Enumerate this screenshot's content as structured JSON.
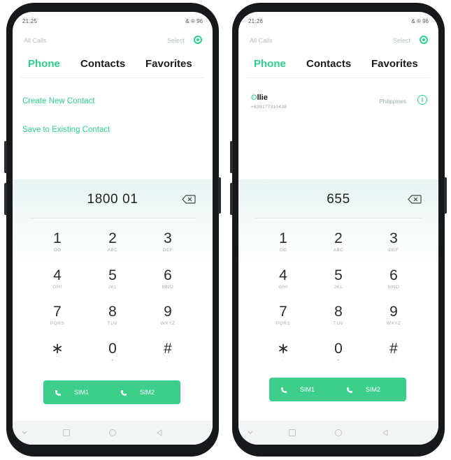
{
  "left_phone": {
    "status_time": "21:25",
    "status_right": "& ® 96",
    "calls_filter": "All Calls",
    "select_label": "Select",
    "tabs": [
      {
        "label": "Phone"
      },
      {
        "label": "Contacts"
      },
      {
        "label": "Favorites"
      }
    ],
    "actions": [
      {
        "label": "Create New Contact"
      },
      {
        "label": "Save to Existing Contact"
      }
    ],
    "dialed_number": "1800 01",
    "sim_buttons": [
      {
        "label": "SIM1"
      },
      {
        "label": "SIM2"
      }
    ]
  },
  "right_phone": {
    "status_time": "21:26",
    "status_right": "& ® 96",
    "calls_filter": "All Calls",
    "select_label": "Select",
    "tabs": [
      {
        "label": "Phone"
      },
      {
        "label": "Contacts"
      },
      {
        "label": "Favorites"
      }
    ],
    "contact": {
      "name_match": "O",
      "name_rest": "llie",
      "number": "+639177310438",
      "country": "Philippines"
    },
    "dialed_number": "655",
    "sim_buttons": [
      {
        "label": "SIM1"
      },
      {
        "label": "SIM2"
      }
    ]
  },
  "keypad": [
    {
      "digit": "1",
      "letters": "OO"
    },
    {
      "digit": "2",
      "letters": "ABC"
    },
    {
      "digit": "3",
      "letters": "DEF"
    },
    {
      "digit": "4",
      "letters": "GHI"
    },
    {
      "digit": "5",
      "letters": "JKL"
    },
    {
      "digit": "6",
      "letters": "MNO"
    },
    {
      "digit": "7",
      "letters": "PQRS"
    },
    {
      "digit": "8",
      "letters": "TUV"
    },
    {
      "digit": "9",
      "letters": "WXYZ"
    },
    {
      "digit": "∗",
      "letters": "·"
    },
    {
      "digit": "0",
      "letters": "+"
    },
    {
      "digit": "#",
      "letters": ";"
    }
  ],
  "colors": {
    "accent": "#2ecf8c",
    "call_bar": "#3dce8b",
    "frame": "#17181b"
  },
  "icons": {
    "backspace": "backspace-icon",
    "call": "phone-call-icon",
    "settings": "settings-icon",
    "info": "info-icon"
  }
}
